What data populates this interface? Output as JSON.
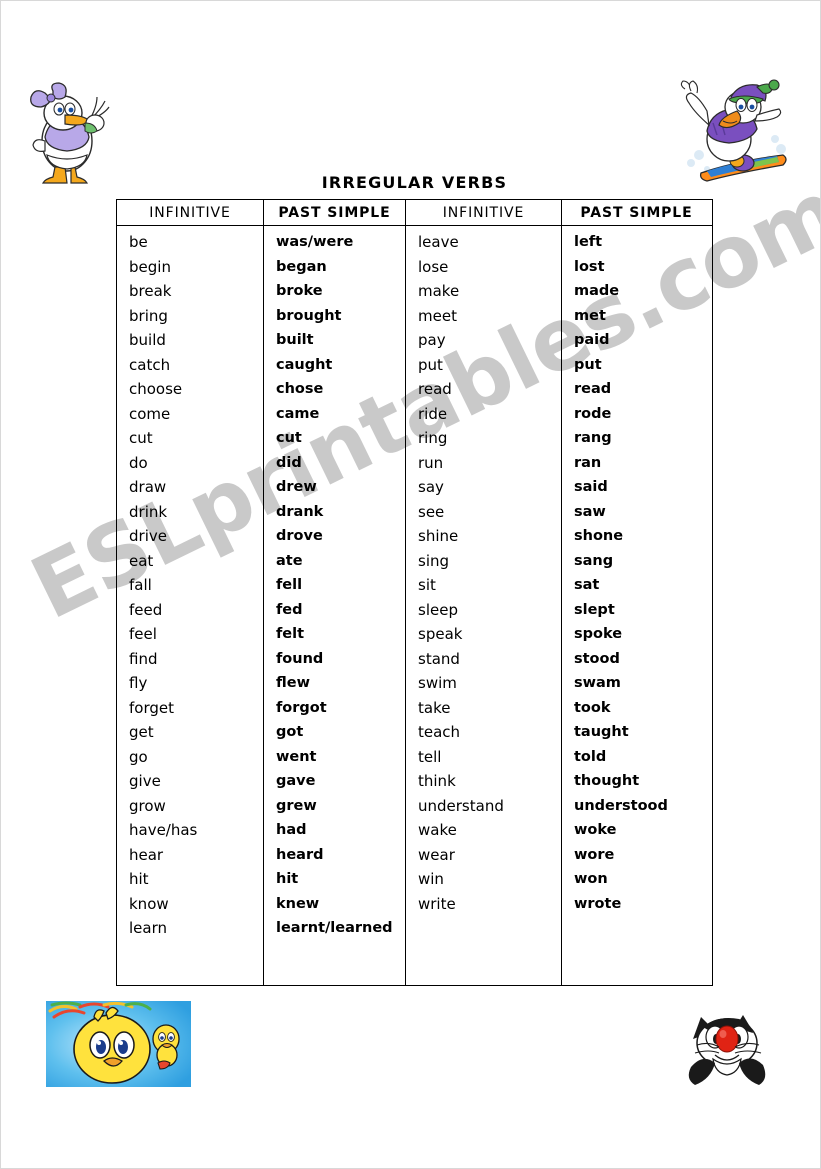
{
  "page": {
    "title": "IRREGULAR VERBS",
    "watermark": "ESLprintables.com",
    "background_color": "#ffffff",
    "border_color": "#d8d8d8",
    "watermark_color": "#c9c9c9"
  },
  "table": {
    "headers": {
      "col1": "INFINITIVE",
      "col2": "PAST SIMPLE",
      "col3": "INFINITIVE",
      "col4": "PAST SIMPLE"
    },
    "left_half": {
      "infinitive": [
        "be",
        "begin",
        "break",
        "bring",
        "build",
        "catch",
        "choose",
        "come",
        "cut",
        "do",
        "draw",
        "drink",
        "drive",
        "eat",
        "fall",
        "feed",
        "feel",
        "find",
        "fly",
        "forget",
        "get",
        "go",
        "give",
        "grow",
        "have/has",
        "hear",
        "hit",
        "know",
        "learn"
      ],
      "past_simple": [
        "was/were",
        "began",
        "broke",
        "brought",
        "built",
        "caught",
        "chose",
        "came",
        "cut",
        "did",
        "drew",
        "drank",
        "drove",
        "ate",
        "fell",
        "fed",
        "felt",
        "found",
        "flew",
        "forgot",
        "got",
        "went",
        "gave",
        "grew",
        "had",
        "heard",
        "hit",
        "knew",
        "learnt/learned"
      ]
    },
    "right_half": {
      "infinitive": [
        "leave",
        "lose",
        "make",
        "meet",
        "pay",
        "put",
        "read",
        "ride",
        "ring",
        "run",
        "say",
        "see",
        "shine",
        "sing",
        "sit",
        "sleep",
        "speak",
        "stand",
        "swim",
        "take",
        "teach",
        "tell",
        "think",
        "understand",
        "wake",
        "wear",
        "win",
        "write"
      ],
      "past_simple": [
        "left",
        "lost",
        "made",
        "met",
        "paid",
        "put",
        "read",
        "rode",
        "rang",
        "ran",
        "said",
        "saw",
        "shone",
        "sang",
        "sat",
        "slept",
        "spoke",
        "stood",
        "swam",
        "took",
        "taught",
        "told",
        "thought",
        "understood",
        "woke",
        "wore",
        "won",
        "wrote"
      ]
    }
  },
  "decorations": {
    "top_left": "daisy-duck-waving",
    "top_right": "donald-duck-snowboarding",
    "bottom_left": "tweety-bird-on-blue-background",
    "bottom_right": "sylvester-cat"
  }
}
